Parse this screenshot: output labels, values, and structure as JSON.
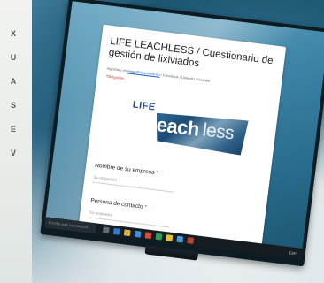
{
  "sidebar": {
    "letters": [
      "X",
      "U",
      "A",
      "S",
      "E",
      "V"
    ]
  },
  "form": {
    "title": "LIFE LEACHLESS / Cuestionario de gestión de lixiviados",
    "meta_prefix": "regístrate en",
    "meta_link": "www.lifeleachless.eu",
    "meta_suffix": "/ Facebook / Linkedin / Youtube",
    "required_note": "*Obligatorio",
    "logo": {
      "life": "LIFE",
      "leach": "leach",
      "less": "less"
    },
    "questions": [
      {
        "label": "Nombre de su empresa",
        "required": "*",
        "placeholder": "Su respuesta"
      },
      {
        "label": "Persona de contacto",
        "required": "*",
        "placeholder": "Su respuesta"
      }
    ]
  },
  "taskbar": {
    "search_placeholder": "Escribe aquí para buscar",
    "tray_text": "ESP"
  },
  "colors": {
    "accent": "#274d86",
    "required": "#d93025",
    "wallpaper": "#2a6e8f",
    "taskbar": "#151d22"
  }
}
